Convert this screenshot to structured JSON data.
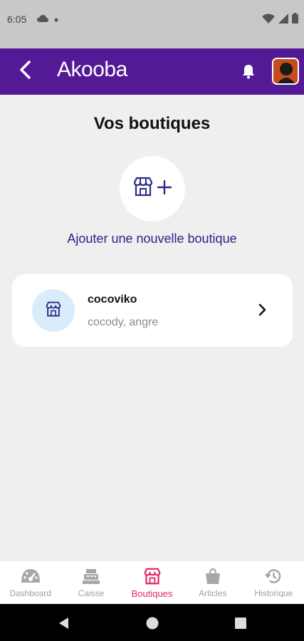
{
  "status_bar": {
    "time": "6:05"
  },
  "app_bar": {
    "logo": "Akooba"
  },
  "page": {
    "title": "Vos boutiques",
    "add_label": "Ajouter une nouvelle boutique"
  },
  "shops": [
    {
      "name": "cocoviko",
      "address": "cocody, angre"
    }
  ],
  "bottom_nav": {
    "items": [
      {
        "label": "Dashboard",
        "icon": "dashboard-icon"
      },
      {
        "label": "Caisse",
        "icon": "cash-register-icon"
      },
      {
        "label": "Boutiques",
        "icon": "store-icon",
        "active": true
      },
      {
        "label": "Articles",
        "icon": "shopping-bag-icon"
      },
      {
        "label": "Historique",
        "icon": "history-icon"
      }
    ]
  },
  "colors": {
    "app_bar": "#541a96",
    "accent_active": "#e2296a",
    "link": "#3a1a8a",
    "shop_icon_bg": "#d9ecfa"
  }
}
